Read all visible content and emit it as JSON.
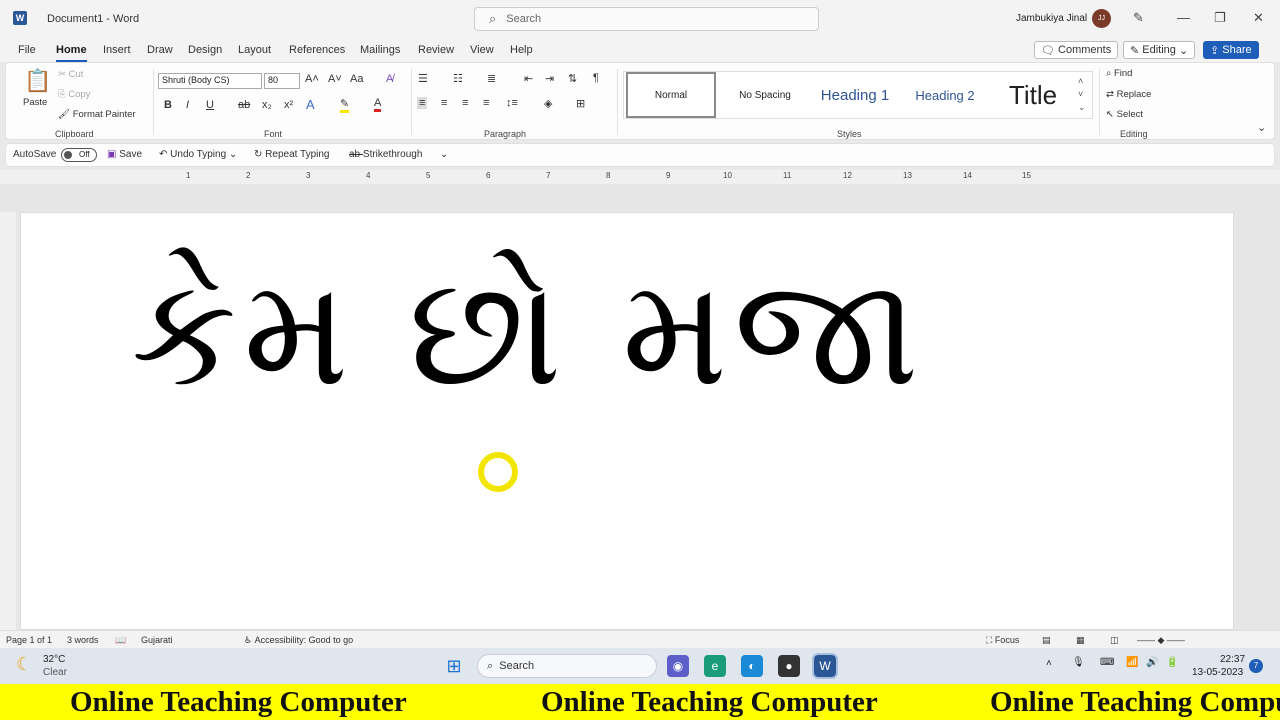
{
  "app": {
    "title": "Document1 - Word",
    "logo": "W"
  },
  "search": {
    "placeholder": "Search"
  },
  "user": {
    "name": "Jambukiya Jinal",
    "initials": "JJ"
  },
  "menu": [
    "File",
    "Home",
    "Insert",
    "Draw",
    "Design",
    "Layout",
    "References",
    "Mailings",
    "Review",
    "View",
    "Help"
  ],
  "actions": {
    "comments": "Comments",
    "editing": "Editing",
    "share": "Share"
  },
  "ribbon": {
    "clipboard": {
      "paste": "Paste",
      "cut": "Cut",
      "copy": "Copy",
      "format_painter": "Format Painter",
      "label": "Clipboard"
    },
    "font": {
      "name": "Shruti (Body CS)",
      "size": "80",
      "label": "Font",
      "bold": "B",
      "italic": "I",
      "underline": "U",
      "strike": "ab",
      "sub": "x₂",
      "sup": "x²",
      "case": "Aa"
    },
    "paragraph": {
      "label": "Paragraph"
    },
    "styles": {
      "label": "Styles",
      "items": [
        "Normal",
        "No Spacing",
        "Heading 1",
        "Heading 2",
        "Title"
      ]
    },
    "editing": {
      "find": "Find",
      "replace": "Replace",
      "select": "Select",
      "label": "Editing"
    }
  },
  "qat": {
    "autosave": "AutoSave",
    "autosave_state": "Off",
    "save": "Save",
    "undo": "Undo Typing",
    "repeat": "Repeat Typing",
    "strike": "Strikethrough"
  },
  "ruler": [
    "1",
    "2",
    "3",
    "4",
    "5",
    "6",
    "7",
    "8",
    "9",
    "10",
    "11",
    "12",
    "13",
    "14",
    "15"
  ],
  "document": {
    "text": "કેમ છો  મજા"
  },
  "status": {
    "page": "Page 1 of 1",
    "words": "3 words",
    "language": "Gujarati",
    "accessibility": "Accessibility: Good to go",
    "focus": "Focus"
  },
  "taskbar": {
    "temp": "32°C",
    "weather": "Clear",
    "search": "Search",
    "time": "22:37",
    "date": "13-05-2023",
    "notifications": "7"
  },
  "banner": {
    "text": "Online Teaching Computer"
  },
  "colors": {
    "accent": "#185abd",
    "banner": "#ffff00"
  }
}
